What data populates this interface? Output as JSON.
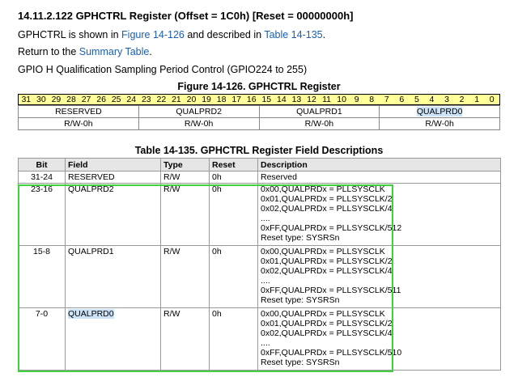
{
  "heading": "14.11.2.122 GPHCTRL Register (Offset = 1C0h) [Reset = 00000000h]",
  "intro": {
    "prefix": "GPHCTRL is shown in ",
    "figure_link": "Figure 14-126",
    "middle": " and described in ",
    "table_link": "Table 14-135",
    "suffix": "."
  },
  "return": {
    "prefix": "Return to the ",
    "link": "Summary Table",
    "suffix": "."
  },
  "desc_line": "GPIO H Qualification Sampling Period Control (GPIO224 to 255)",
  "figure_title": "Figure 14-126. GPHCTRL Register",
  "bits": [
    "31",
    "30",
    "29",
    "28",
    "27",
    "26",
    "25",
    "24",
    "23",
    "22",
    "21",
    "20",
    "19",
    "18",
    "17",
    "16",
    "15",
    "14",
    "13",
    "12",
    "11",
    "10",
    "9",
    "8",
    "7",
    "6",
    "5",
    "4",
    "3",
    "2",
    "1",
    "0"
  ],
  "register_fields": [
    "RESERVED",
    "QUALPRD2",
    "QUALPRD1",
    "QUALPRD0"
  ],
  "register_access": [
    "R/W-0h",
    "R/W-0h",
    "R/W-0h",
    "R/W-0h"
  ],
  "table_title": "Table 14-135. GPHCTRL Register Field Descriptions",
  "columns": [
    "Bit",
    "Field",
    "Type",
    "Reset",
    "Description"
  ],
  "rows": [
    {
      "bit": "31-24",
      "field": "RESERVED",
      "type": "R/W",
      "reset": "0h",
      "desc": [
        "Reserved"
      ]
    },
    {
      "bit": "23-16",
      "field": "QUALPRD2",
      "type": "R/W",
      "reset": "0h",
      "desc": [
        "0x00,QUALPRDx = PLLSYSCLK",
        "0x01,QUALPRDx = PLLSYSCLK/2",
        "0x02,QUALPRDx = PLLSYSCLK/4",
        "....",
        "0xFF,QUALPRDx = PLLSYSCLK/512",
        "Reset type: SYSRSn"
      ]
    },
    {
      "bit": "15-8",
      "field": "QUALPRD1",
      "type": "R/W",
      "reset": "0h",
      "desc": [
        "0x00,QUALPRDx = PLLSYSCLK",
        "0x01,QUALPRDx = PLLSYSCLK/2",
        "0x02,QUALPRDx = PLLSYSCLK/4",
        "....",
        "0xFF,QUALPRDx = PLLSYSCLK/511",
        "Reset type: SYSRSn"
      ]
    },
    {
      "bit": "7-0",
      "field": "QUALPRD0",
      "type": "R/W",
      "reset": "0h",
      "desc": [
        "0x00,QUALPRDx = PLLSYSCLK",
        "0x01,QUALPRDx = PLLSYSCLK/2",
        "0x02,QUALPRDx = PLLSYSCLK/4",
        "....",
        "0xFF,QUALPRDx = PLLSYSCLK/510",
        "Reset type: SYSRSn"
      ]
    }
  ],
  "colors": {
    "bit_header": "#ffff99",
    "highlight": "#cde3f7",
    "selection_box": "#3fd13f",
    "link": "#1a5fb4"
  }
}
